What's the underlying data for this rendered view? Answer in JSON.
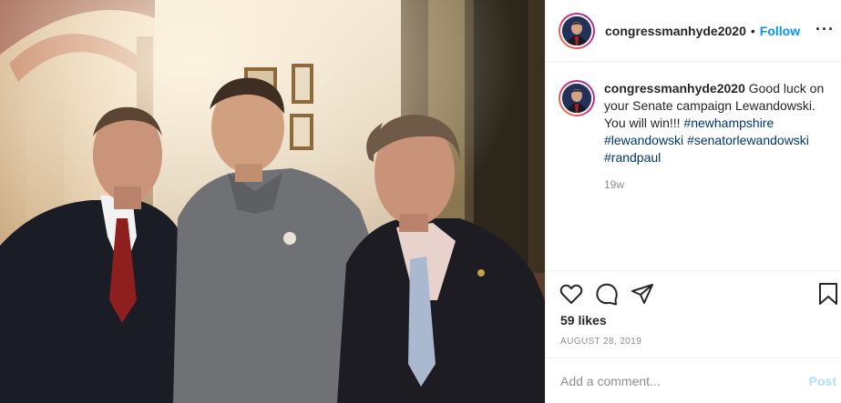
{
  "post": {
    "username": "congressmanhyde2020",
    "separator": "•",
    "follow_label": "Follow",
    "more_label": "···",
    "caption_text": "Good luck on your Senate campaign Lewandowski. You will win!!!",
    "hashtags": [
      "#newhampshire",
      "#lewandowski",
      "#senatorlewandowski",
      "#randpaul"
    ],
    "age": "19w",
    "likes": "59 likes",
    "date": "AUGUST 28, 2019",
    "comment_placeholder": "Add a comment...",
    "post_label": "Post"
  },
  "icons": {
    "like": "heart-icon",
    "comment": "comment-icon",
    "share": "share-icon",
    "save": "bookmark-icon",
    "more": "more-icon"
  },
  "colors": {
    "accent": "#0095f6",
    "hashtag": "#00376b",
    "muted": "#8e8e8e",
    "post_disabled": "#b2dffc",
    "divider": "#efefef"
  }
}
